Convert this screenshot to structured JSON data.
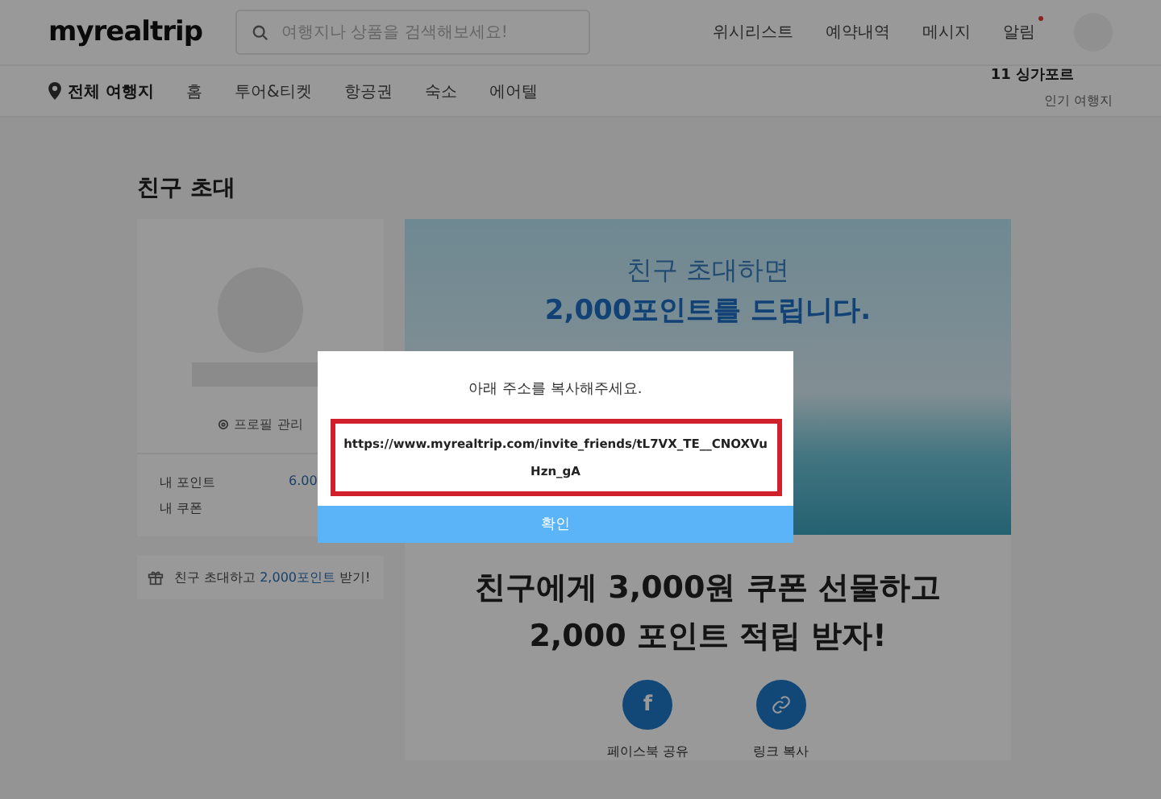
{
  "header": {
    "logo": "myrealtrip",
    "search": {
      "placeholder": "여행지나 상품을 검색해보세요!"
    },
    "menu": [
      {
        "label": "위시리스트",
        "unread": false
      },
      {
        "label": "예약내역",
        "unread": false
      },
      {
        "label": "메시지",
        "unread": false
      },
      {
        "label": "알림",
        "unread": true
      }
    ]
  },
  "nav": {
    "location": "전체 여행지",
    "items": [
      {
        "label": "홈",
        "selected": false
      },
      {
        "label": "투어&티켓",
        "selected": false
      },
      {
        "label": "항공권",
        "selected": false
      },
      {
        "label": "숙소",
        "selected": false
      },
      {
        "label": "에어텔",
        "selected": false
      }
    ],
    "popular_label": "인기 여행지",
    "popular_items": [
      "11 싱가포르"
    ]
  },
  "page_title": "친구 초대",
  "profile": {
    "manage_label": "프로필 관리",
    "stats": [
      {
        "label": "내 포인트",
        "value": "6.00"
      },
      {
        "label": "내 쿠폰"
      }
    ],
    "invite": {
      "text": "친구 초대하고 **2,000포인트** 받기!"
    }
  },
  "banner": {
    "line1": "친구 초대하면",
    "line2": "2,000포인트를 드립니다."
  },
  "headline": [
    "친구에게 3,000원 쿠폰 선물하고",
    "2,000 포인트 적립 받자!"
  ],
  "share": [
    {
      "kind": "facebook",
      "icon": "f",
      "label": "페이스북 공유"
    },
    {
      "kind": "link",
      "label": "링크 복사"
    }
  ],
  "dialog": {
    "message": "아래 주소를 복사해주세요.",
    "url": "https://www.myrealtrip.com/invite_friends/tL7VX_TE__CNOXVuHzn_gA",
    "button": "확인"
  }
}
